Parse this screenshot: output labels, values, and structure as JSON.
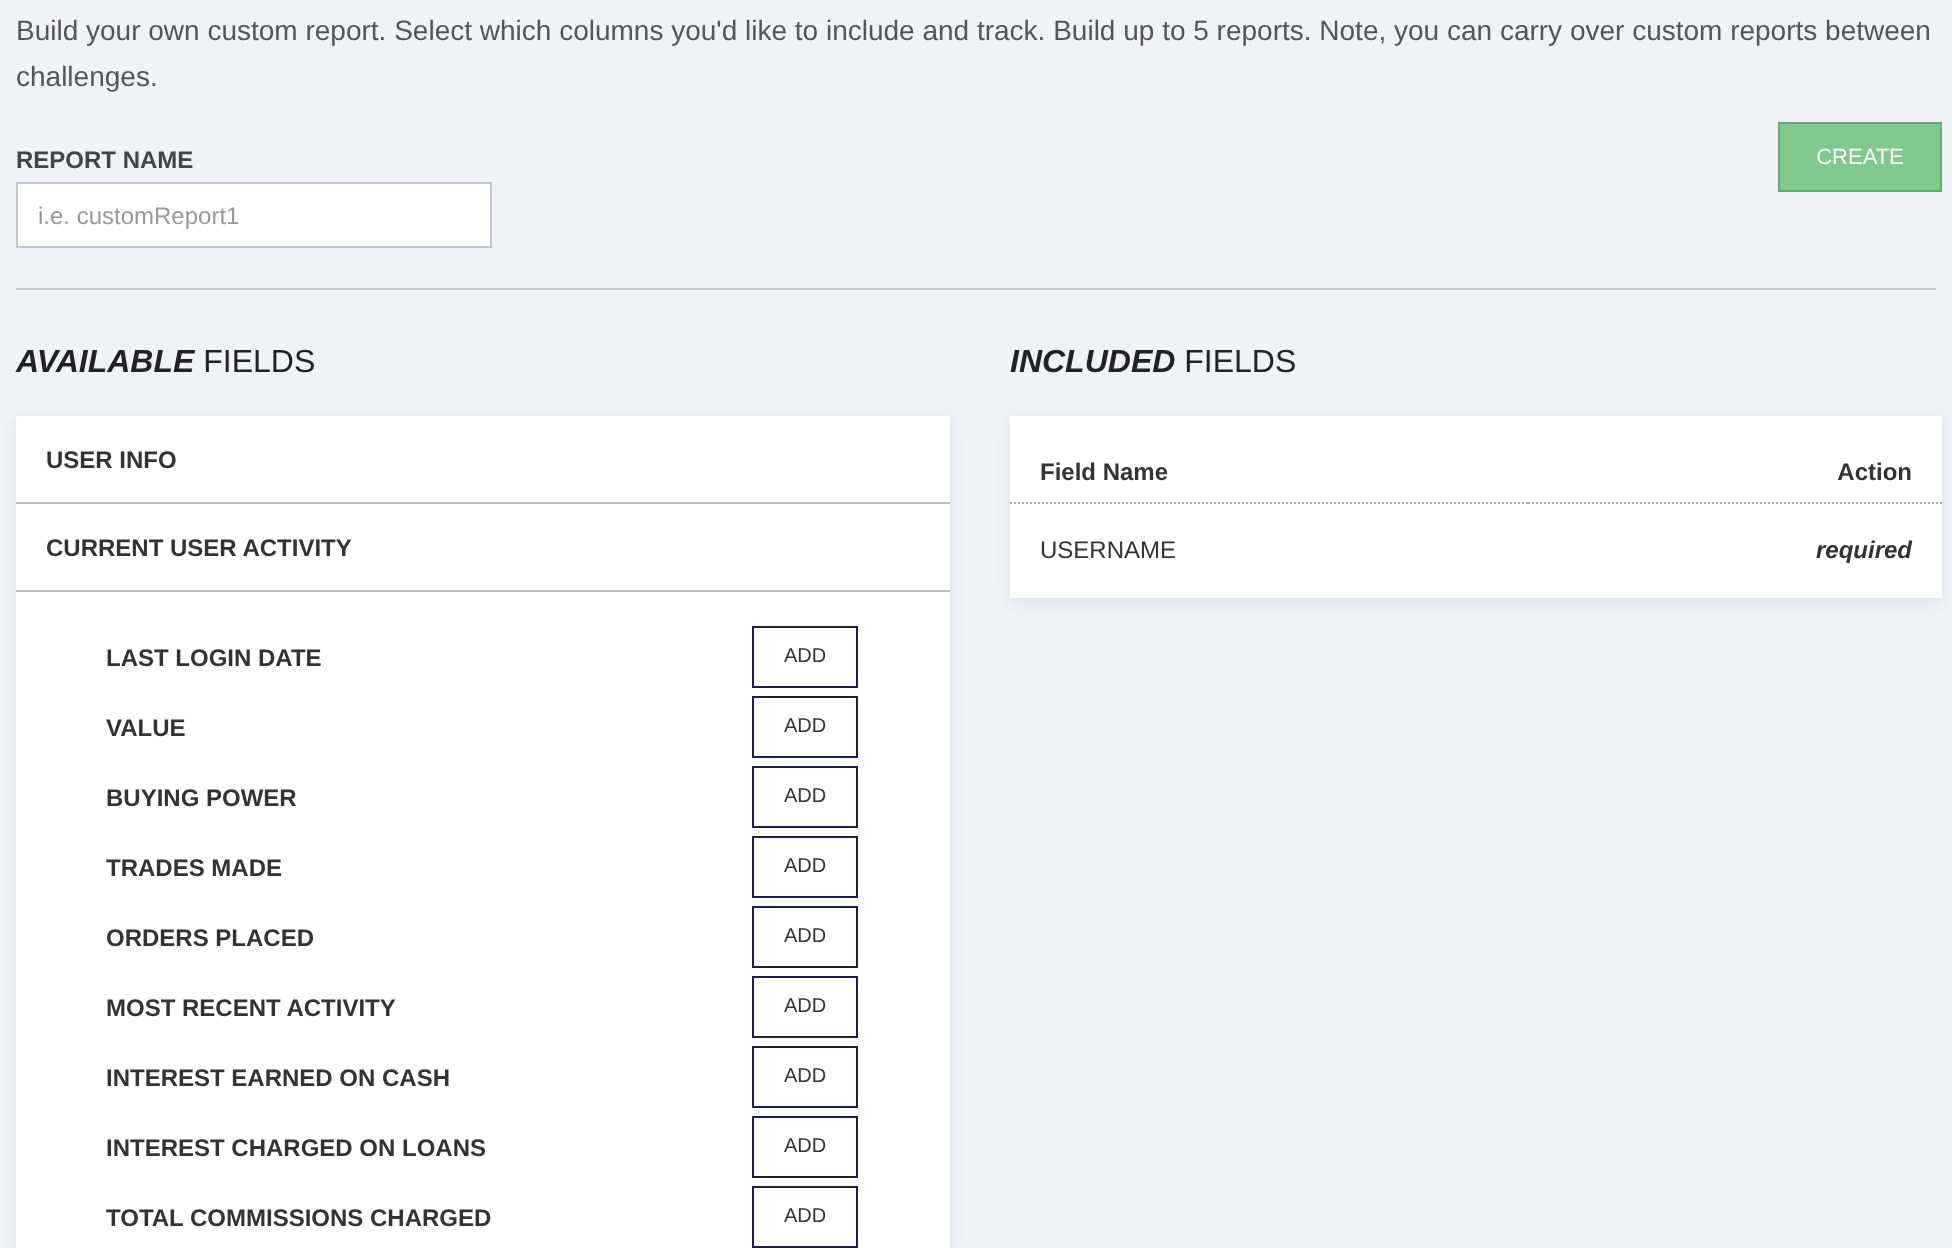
{
  "intro": "Build your own custom report. Select which columns you'd like to include and track. Build up to 5 reports. Note, you can carry over custom reports between challenges.",
  "report_name": {
    "label": "REPORT NAME",
    "placeholder": "i.e. customReport1"
  },
  "create_button": {
    "label": "CREATE",
    "disabled": true
  },
  "available": {
    "heading": "**AVAILABLE** FIELDS",
    "sections": [
      {
        "label": "USER INFO"
      },
      {
        "label": "CURRENT USER ACTIVITY",
        "fields": [
          {
            "name": "LAST LOGIN DATE",
            "button": "ADD"
          },
          {
            "name": "VALUE",
            "button": "ADD"
          },
          {
            "name": "BUYING POWER",
            "button": "ADD"
          },
          {
            "name": "TRADES MADE",
            "button": "ADD"
          },
          {
            "name": "ORDERS PLACED",
            "button": "ADD"
          },
          {
            "name": "MOST RECENT ACTIVITY",
            "button": "ADD"
          },
          {
            "name": "INTEREST EARNED ON CASH",
            "button": "ADD"
          },
          {
            "name": "INTEREST CHARGED ON LOANS",
            "button": "ADD"
          },
          {
            "name": "TOTAL COMMISSIONS CHARGED",
            "button": "ADD"
          }
        ]
      }
    ]
  },
  "included": {
    "heading": "**INCLUDED** FIELDS",
    "columns": [
      "Field Name",
      "Action"
    ],
    "rows": [
      {
        "field": "USERNAME",
        "action": "required"
      }
    ]
  }
}
